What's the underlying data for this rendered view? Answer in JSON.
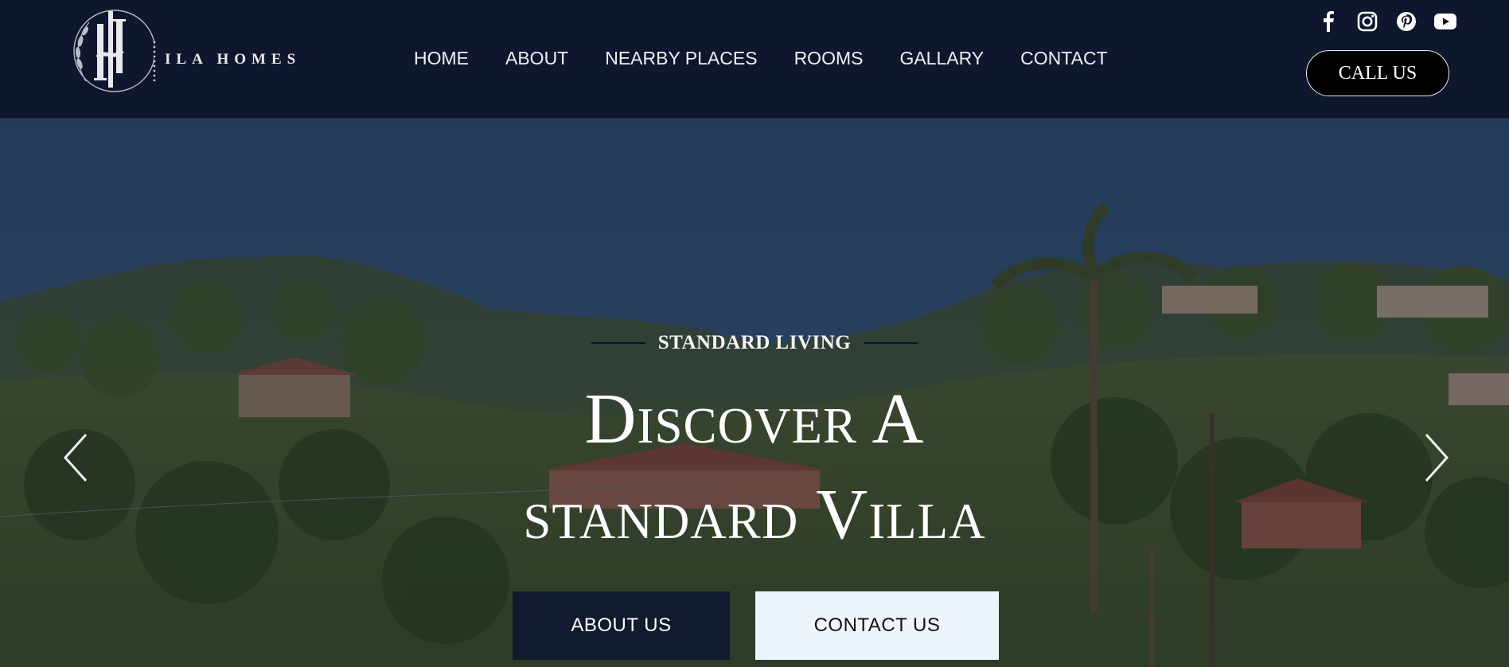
{
  "brand": {
    "name": "ILA HOMES"
  },
  "nav": {
    "items": [
      {
        "label": "HOME"
      },
      {
        "label": "ABOUT"
      },
      {
        "label": "NEARBY PLACES"
      },
      {
        "label": "ROOMS"
      },
      {
        "label": "GALLARY"
      },
      {
        "label": "CONTACT"
      }
    ]
  },
  "social": [
    "facebook-icon",
    "instagram-icon",
    "pinterest-icon",
    "youtube-icon"
  ],
  "header": {
    "call_label": "CALL US"
  },
  "hero": {
    "eyebrow": "STANDARD LIVING",
    "headline_line1": "Discover A",
    "headline_line2": "standard Villa",
    "about_btn": "ABOUT US",
    "contact_btn": "CONTACT US"
  },
  "colors": {
    "header_bg": "#0f172e",
    "primary_button": "#111a2f",
    "secondary_button": "#eef4fc",
    "text_light": "#ffffff"
  }
}
